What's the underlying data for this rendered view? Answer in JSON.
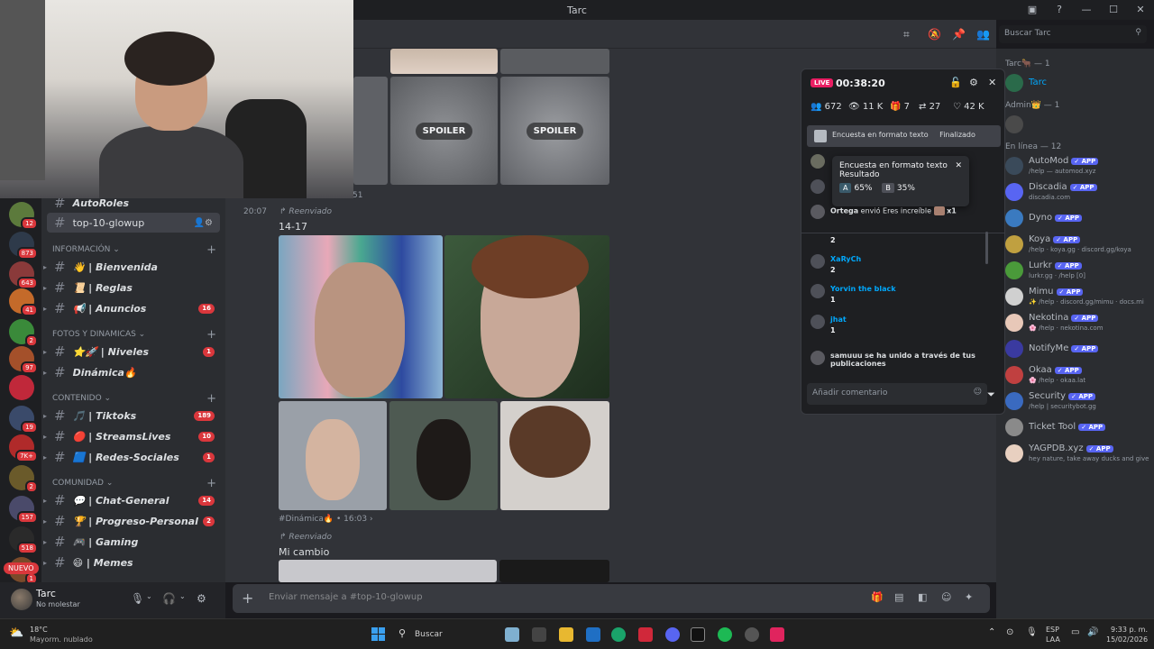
{
  "window": {
    "title": "Tarc"
  },
  "search": {
    "placeholder": "Buscar Tarc"
  },
  "servers": [
    {
      "badge": "12"
    },
    {
      "badge": "873"
    },
    {
      "badge": "643"
    },
    {
      "badge": "41"
    },
    {
      "badge": "2"
    },
    {
      "badge": "97"
    },
    {
      "badge": ""
    },
    {
      "badge": "19"
    },
    {
      "badge": "7K+"
    },
    {
      "badge": "2"
    },
    {
      "badge": "157"
    },
    {
      "badge": "518"
    },
    {
      "badge": "1"
    }
  ],
  "new_label": "NUEVO",
  "channels": {
    "top_partial": "AutoRoles",
    "active": "top-10-glowup",
    "categories": [
      {
        "name": "INFORMACIÓN",
        "items": [
          {
            "label": "👋 | Bienvenida",
            "count": ""
          },
          {
            "label": "📜 | Reglas",
            "count": ""
          },
          {
            "label": "📢 | Anuncios",
            "count": "16"
          }
        ]
      },
      {
        "name": "FOTOS Y DINAMICAS",
        "items": [
          {
            "label": "⭐🚀 | Niveles",
            "count": "1"
          },
          {
            "label": "Dinámica🔥",
            "count": ""
          }
        ]
      },
      {
        "name": "CONTENIDO",
        "items": [
          {
            "label": "🎵 | Tiktoks",
            "count": "189"
          },
          {
            "label": "🔴 | StreamsLives",
            "count": "10"
          },
          {
            "label": "🟦 | Redes-Sociales",
            "count": "1"
          }
        ]
      },
      {
        "name": "COMUNIDAD",
        "items": [
          {
            "label": "💬 | Chat-General",
            "count": "14"
          },
          {
            "label": "🏆 | Progreso-Personal",
            "count": "2"
          },
          {
            "label": "🎮 | Gaming",
            "count": ""
          },
          {
            "label": "😄 | Memes",
            "count": ""
          }
        ]
      }
    ]
  },
  "user": {
    "name": "Tarc",
    "status": "No molestar"
  },
  "chat": {
    "spoiler_label": "SPOILER",
    "partial_count": "51",
    "msg1": {
      "time": "20:07",
      "forwarded": "Reenviado",
      "text": "14-17"
    },
    "src1": {
      "channel": "#Dinámica🔥",
      "time": "16:03"
    },
    "msg2": {
      "forwarded": "Reenviado",
      "text": "Mi cambio"
    }
  },
  "composer": {
    "placeholder": "Enviar mensaje a #top-10-glowup"
  },
  "live": {
    "badge": "LIVE",
    "time": "00:38:20",
    "stats": {
      "viewers": "672",
      "views": "11 K",
      "gifts": "7",
      "shares": "27",
      "likes": "42 K"
    },
    "poll": {
      "title": "Encuesta en formato texto",
      "status": "Finalizado"
    },
    "tooltip": {
      "title": "Encuesta en formato texto",
      "subtitle": "Resultado",
      "a_label": "A",
      "a_value": "65%",
      "b_label": "B",
      "b_value": "35%"
    },
    "gift_line": {
      "user": "Ortega",
      "text": "envió Eres increíble",
      "mult": "x1"
    },
    "rows": [
      {
        "name": "",
        "value": "2"
      },
      {
        "name": "XaRyCh",
        "value": "2"
      },
      {
        "name": "Yorvin the black",
        "value": "1"
      },
      {
        "name": "jhat",
        "value": "1"
      }
    ],
    "join": {
      "user": "samuuu",
      "text": "se ha unido a través de tus publicaciones"
    },
    "comment_placeholder": "Añadir comentario"
  },
  "members": {
    "groups": [
      {
        "name": "Tarc🐂 — 1",
        "items": [
          {
            "name": "Tarc",
            "sub": "",
            "app": false
          }
        ]
      },
      {
        "name": "Admin👑 — 1",
        "items": [
          {
            "name": "",
            "sub": "",
            "app": false
          }
        ]
      },
      {
        "name": "En línea — 12",
        "items": [
          {
            "name": "AutoMod",
            "sub": "/help — automod.xyz",
            "app": true
          },
          {
            "name": "Discadia",
            "sub": "discadia.com",
            "app": true
          },
          {
            "name": "Dyno",
            "sub": "",
            "app": true
          },
          {
            "name": "Koya",
            "sub": "/help · koya.gg · discord.gg/koya",
            "app": true
          },
          {
            "name": "Lurkr",
            "sub": "lurkr.gg · /help [0]",
            "app": true
          },
          {
            "name": "Mimu",
            "sub": "✨ /help · discord.gg/mimu · docs.mi",
            "app": true
          },
          {
            "name": "Nekotina",
            "sub": "🌸 /help · nekotina.com",
            "app": true
          },
          {
            "name": "NotifyMe",
            "sub": "",
            "app": true
          },
          {
            "name": "Okaa",
            "sub": "🌸 /help · okaa.lat",
            "app": true
          },
          {
            "name": "Security",
            "sub": "/help | securitybot.gg",
            "app": true
          },
          {
            "name": "Ticket Tool",
            "sub": "",
            "app": true
          },
          {
            "name": "YAGPDB.xyz",
            "sub": "hey nature, take away ducks and give",
            "app": true
          }
        ]
      }
    ],
    "app_label": "APP"
  },
  "taskbar": {
    "weather_temp": "18°C",
    "weather_desc": "Mayorm. nublado",
    "search": "Buscar",
    "lang1": "ESP",
    "lang2": "LAA",
    "time": "9:33 p. m.",
    "date": "15/02/2026"
  }
}
